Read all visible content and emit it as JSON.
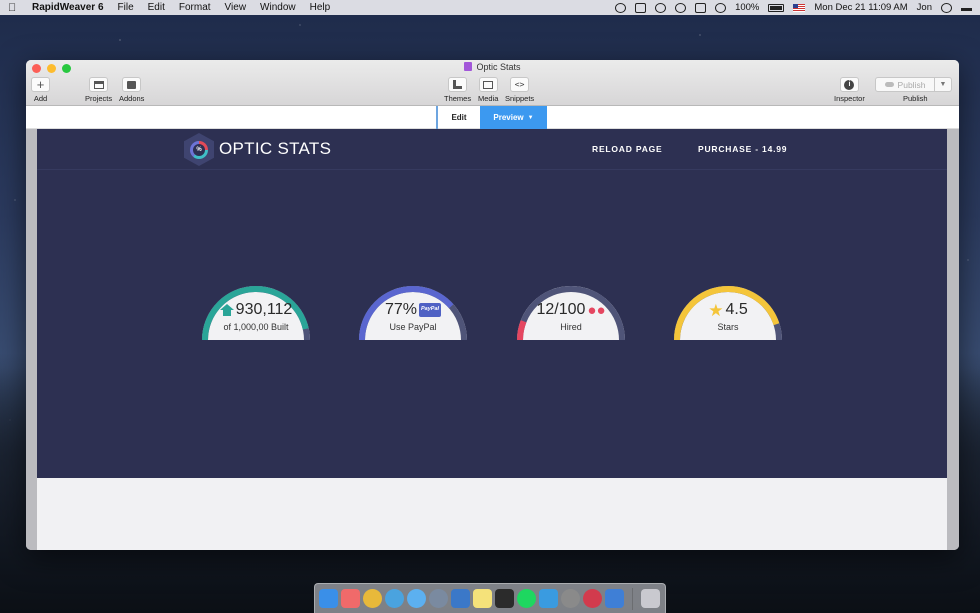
{
  "menubar": {
    "app_name": "RapidWeaver 6",
    "menus": [
      "File",
      "Edit",
      "Format",
      "View",
      "Window",
      "Help"
    ],
    "battery": "100%",
    "datetime": "Mon Dec 21  11:09 AM",
    "user": "Jon"
  },
  "window": {
    "title": "Optic Stats",
    "toolbar": {
      "add": "Add",
      "projects": "Projects",
      "addons": "Addons",
      "themes": "Themes",
      "media": "Media",
      "snippets": "Snippets",
      "inspector": "Inspector",
      "publish_button": "Publish",
      "publish": "Publish"
    },
    "modes": {
      "edit": "Edit",
      "preview": "Preview"
    }
  },
  "site": {
    "logo_glyph": "%",
    "title": "OPTIC STATS",
    "nav": [
      "RELOAD PAGE",
      "PURCHASE - 14.99"
    ],
    "gauges": [
      {
        "value": "930,112",
        "label": "of 1,000,00 Built",
        "icon": "home-icon",
        "color": "#2aa598",
        "fraction": 0.93
      },
      {
        "value": "77%",
        "label": "Use PayPal",
        "icon": "paypal-icon",
        "icon_text": "PayPal",
        "color": "#5a66cf",
        "fraction": 0.77
      },
      {
        "value": "12/100",
        "label": "Hired",
        "icon": "users-icon",
        "color": "#e54660",
        "fraction": 0.12
      },
      {
        "value": "4.5",
        "label": "Stars",
        "icon": "star-icon",
        "color": "#f4c53a",
        "fraction": 0.9
      }
    ]
  },
  "dock": {
    "apps": [
      "finder",
      "asana",
      "chrome",
      "tweetbot",
      "messages",
      "launchpad",
      "1password",
      "notes",
      "terminal",
      "spotify",
      "xcode",
      "system-preferences",
      "airmail",
      "rapidweaver",
      "trash"
    ]
  }
}
